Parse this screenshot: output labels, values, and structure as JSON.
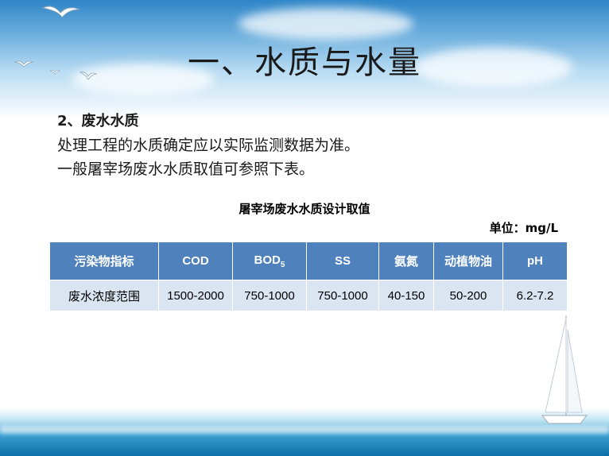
{
  "slide": {
    "title": "一、水质与水量",
    "subheading": "2、废水水质",
    "paragraphs": [
      "处理工程的水质确定应以实际监测数据为准。",
      "一般屠宰场废水水质取值可参照下表。"
    ]
  },
  "table": {
    "title": "屠宰场废水水质设计取值",
    "unit": "单位：mg/L",
    "headers": [
      "污染物指标",
      "COD",
      "BOD",
      "SS",
      "氨氮",
      "动植物油",
      "pH"
    ],
    "bod_subscript": "5",
    "row": [
      "废水浓度范围",
      "1500-2000",
      "750-1000",
      "750-1000",
      "40-150",
      "50-200",
      "6.2-7.2"
    ]
  },
  "colors": {
    "header_bg": "#4f81bd",
    "cell_bg": "#dbe5f1",
    "sky": "#2f86c8",
    "sea": "#0d6fa8"
  }
}
